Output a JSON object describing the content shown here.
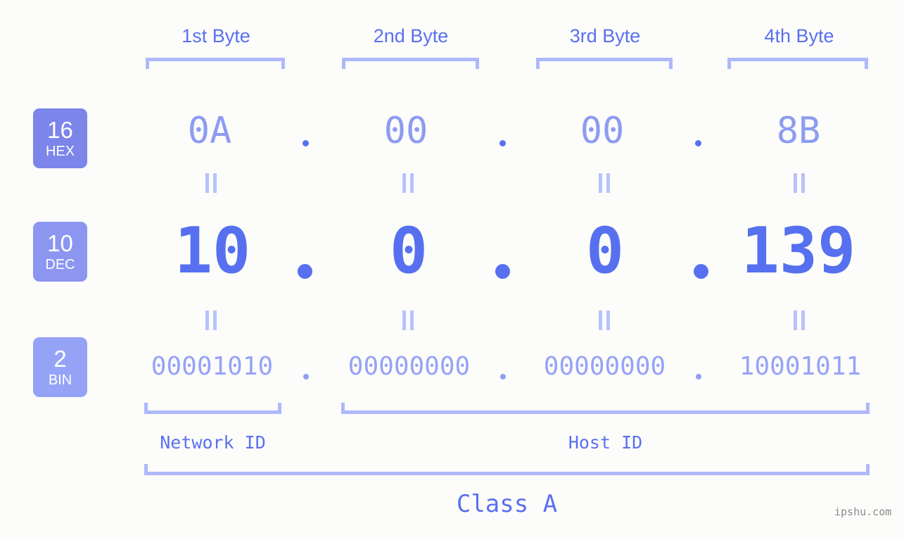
{
  "columns": [
    {
      "header": "1st Byte",
      "hex": "0A",
      "dec": "10",
      "bin": "00001010"
    },
    {
      "header": "2nd Byte",
      "hex": "00",
      "dec": "0",
      "bin": "00000000"
    },
    {
      "header": "3rd Byte",
      "hex": "00",
      "dec": "0",
      "bin": "00000000"
    },
    {
      "header": "4th Byte",
      "hex": "8B",
      "dec": "139",
      "bin": "10001011"
    }
  ],
  "rows": [
    {
      "badge_num": "16",
      "badge_name": "HEX",
      "badge_color": "#7b85ea"
    },
    {
      "badge_num": "10",
      "badge_name": "DEC",
      "badge_color": "#8c96f0"
    },
    {
      "badge_num": "2",
      "badge_name": "BIN",
      "badge_color": "#95a3f7"
    }
  ],
  "separators": {
    "dot": "."
  },
  "sections": {
    "network_id": "Network ID",
    "host_id": "Host ID",
    "ip_class": "Class A"
  },
  "watermark": "ipshu.com",
  "colors": {
    "background": "#fcfdfa",
    "accent": "#5670ef",
    "bracket": "#aeb8fb",
    "muted": "#8d9bf2"
  }
}
